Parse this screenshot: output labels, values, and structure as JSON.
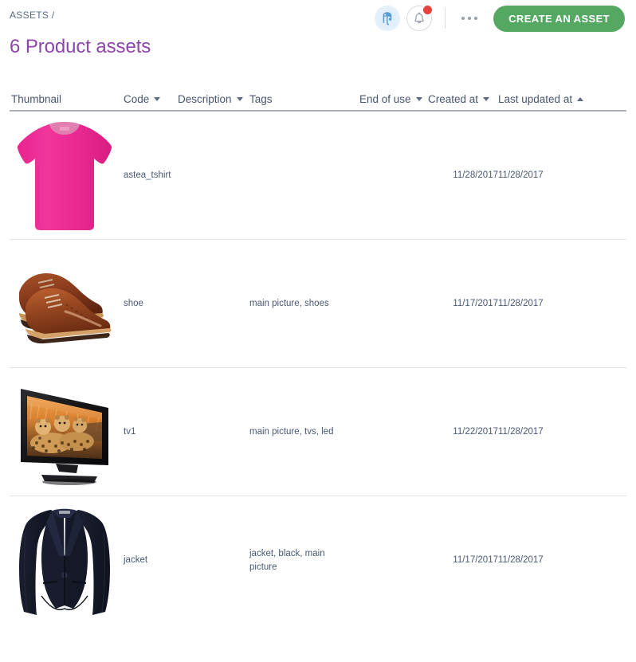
{
  "header": {
    "breadcrumb": "ASSETS /",
    "title": "6 Product assets",
    "avatar_icon": "user-avatar-elephant-icon",
    "bell_icon": "notification-bell-icon",
    "bell_has_badge": true,
    "more_menu_icon": "more-horizontal-icon",
    "create_button_label": "CREATE AN ASSET",
    "accent_purple": "#8e44ad",
    "accent_green": "#54a862",
    "badge_red": "#e8413b"
  },
  "table": {
    "columns": [
      {
        "key": "thumbnail",
        "label": "Thumbnail",
        "sortable": false,
        "sort": "none"
      },
      {
        "key": "code",
        "label": "Code",
        "sortable": true,
        "sort": "menu"
      },
      {
        "key": "description",
        "label": "Description",
        "sortable": true,
        "sort": "menu"
      },
      {
        "key": "tags",
        "label": "Tags",
        "sortable": false,
        "sort": "none"
      },
      {
        "key": "end_of_use",
        "label": "End of use",
        "sortable": true,
        "sort": "menu"
      },
      {
        "key": "created_at",
        "label": "Created at",
        "sortable": true,
        "sort": "menu"
      },
      {
        "key": "last_updated_at",
        "label": "Last updated at",
        "sortable": true,
        "sort": "asc"
      }
    ],
    "rows": [
      {
        "thumbnail_alt": "pink-tshirt-thumbnail",
        "code": "astea_tshirt",
        "description": "",
        "tags": "",
        "end_of_use": "",
        "created_at": "11/28/2017",
        "last_updated_at": "11/28/2017"
      },
      {
        "thumbnail_alt": "brown-leather-shoes-thumbnail",
        "code": "shoe",
        "description": "",
        "tags": "main picture, shoes",
        "end_of_use": "",
        "created_at": "11/17/2017",
        "last_updated_at": "11/28/2017"
      },
      {
        "thumbnail_alt": "flat-screen-tv-cheetahs-thumbnail",
        "code": "tv1",
        "description": "",
        "tags": "main picture, tvs, led",
        "end_of_use": "",
        "created_at": "11/22/2017",
        "last_updated_at": "11/28/2017"
      },
      {
        "thumbnail_alt": "navy-blazer-jacket-thumbnail",
        "code": "jacket",
        "description": "",
        "tags": "jacket, black, main picture",
        "end_of_use": "",
        "created_at": "11/17/2017",
        "last_updated_at": "11/28/2017"
      }
    ]
  }
}
